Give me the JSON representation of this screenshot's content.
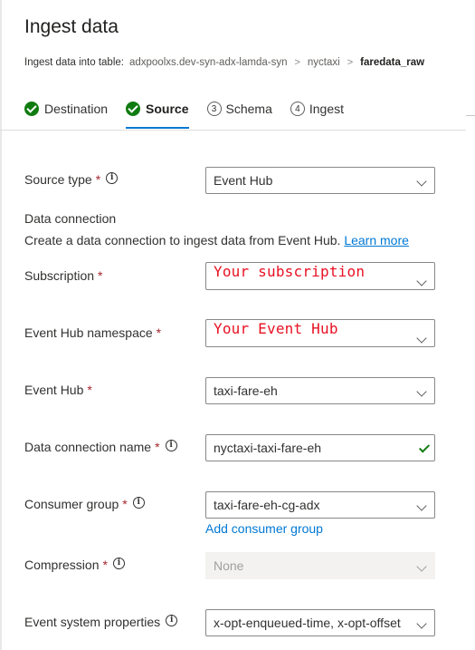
{
  "header": {
    "title": "Ingest data",
    "breadcrumb": {
      "lead": "Ingest data into table:",
      "cluster": "adxpoolxs.dev-syn-adx-lamda-syn",
      "database": "nyctaxi",
      "table": "faredata_raw",
      "separator": ">"
    }
  },
  "tabs": [
    {
      "label": "Destination",
      "status": "done"
    },
    {
      "label": "Source",
      "status": "done",
      "active": true
    },
    {
      "label": "Schema",
      "number": "3"
    },
    {
      "label": "Ingest",
      "number": "4"
    }
  ],
  "form": {
    "required_marker": "*",
    "info_glyph": "i",
    "source_type": {
      "label": "Source type",
      "value": "Event Hub"
    },
    "data_connection": {
      "heading": "Data connection",
      "description": "Create a data connection to ingest data from Event Hub.",
      "learn_more": "Learn more"
    },
    "subscription": {
      "label": "Subscription",
      "value": "Your subscription"
    },
    "namespace": {
      "label": "Event Hub namespace",
      "value": "Your Event Hub"
    },
    "event_hub": {
      "label": "Event Hub",
      "value": "taxi-fare-eh"
    },
    "connection_name": {
      "label": "Data connection name",
      "value": "nyctaxi-taxi-fare-eh"
    },
    "consumer_group": {
      "label": "Consumer group",
      "value": "taxi-fare-eh-cg-adx",
      "add_link": "Add consumer group"
    },
    "compression": {
      "label": "Compression",
      "value": "None"
    },
    "system_properties": {
      "label": "Event system properties",
      "value": "x-opt-enqueued-time, x-opt-offset"
    }
  },
  "colors": {
    "accent": "#0078d4",
    "success": "#107c10",
    "required": "#a4262c",
    "annotation": "#e81123"
  }
}
